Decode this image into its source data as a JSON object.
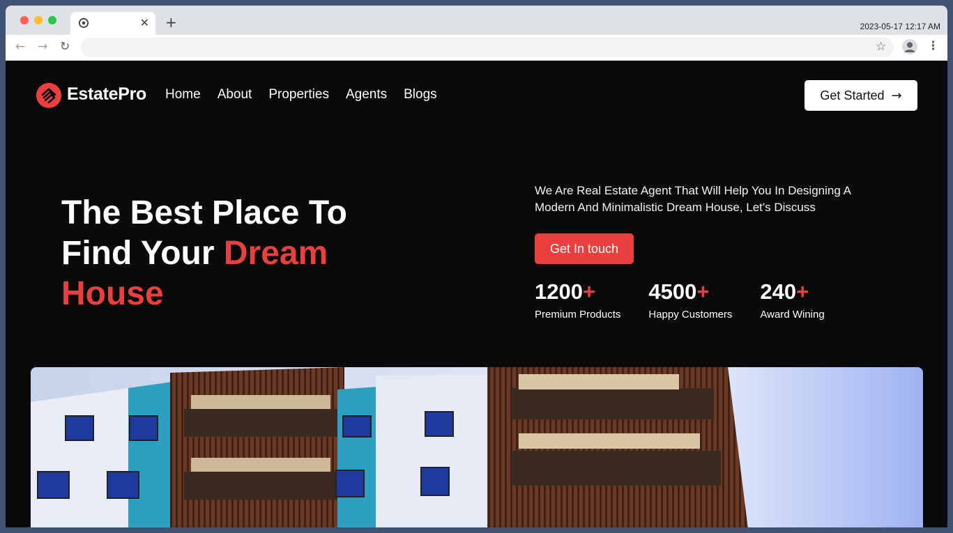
{
  "browser": {
    "clock": "2023-05-17 12:17 AM",
    "tab_close": "✕",
    "new_tab": "+",
    "back_glyph": "←",
    "forward_glyph": "→",
    "reload_glyph": "↻",
    "star_glyph": "☆",
    "menu_glyph": "⋮"
  },
  "header": {
    "brand": "EstatePro",
    "nav": [
      "Home",
      "About",
      "Properties",
      "Agents",
      "Blogs"
    ],
    "cta_label": "Get Started",
    "cta_arrow": "→"
  },
  "hero": {
    "title_line1": "The Best Place To",
    "title_line2_plain": "Find Your ",
    "title_line2_accent": "Dream",
    "title_line3_accent": "House",
    "description": "We Are Real Estate Agent That Will Help You In Designing A Modern And Minimalistic Dream House, Let's Discuss",
    "button_label": "Get In touch",
    "stats": [
      {
        "value": "1200",
        "suffix": "+",
        "label": "Premium Products"
      },
      {
        "value": "4500",
        "suffix": "+",
        "label": "Happy Customers"
      },
      {
        "value": "240",
        "suffix": "+",
        "label": "Award Wining"
      }
    ]
  },
  "colors": {
    "accent": "#e8403f",
    "background": "#0b0a0a",
    "button_light": "#ffffff"
  },
  "icons": {
    "logo": "house-logo-icon",
    "cta": "arrow-right-icon",
    "favicon": "chrome-icon",
    "profile": "user-avatar-icon"
  }
}
